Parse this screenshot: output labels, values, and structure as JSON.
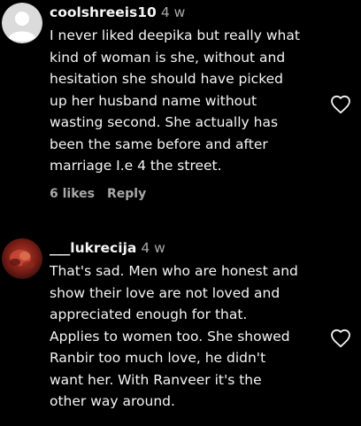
{
  "comments": [
    {
      "username": "coolshreeis10",
      "time": "4 w",
      "text": "I never liked deepika but really what\nkind of woman is she, without and\nhesitation she should have picked\nup her husband name without\nwasting second. She actually has\nbeen the same before and after\nmarriage I.e 4 the street.",
      "likes": "6 likes",
      "reply": "Reply",
      "avatar": "default-avatar-icon",
      "like_icon": "heart-outline-icon"
    },
    {
      "username": "___lukrecija",
      "time": "4 w",
      "text": "That's sad. Men who are honest and\nshow their love are not loved and\nappreciated enough for that.\nApplies to women too. She showed\nRanbir too much love, he didn't\nwant her. With Ranveer it's the\nother way around.",
      "avatar": "profile-photo-avatar",
      "like_icon": "heart-outline-icon"
    }
  ],
  "colors": {
    "background": "#000000",
    "text": "#f5f5f5",
    "secondary": "#a8a8a8"
  }
}
